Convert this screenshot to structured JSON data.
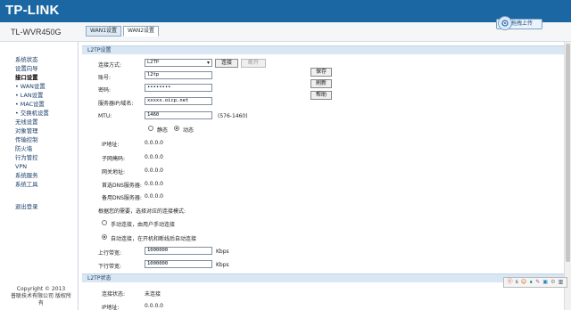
{
  "header": {
    "logo": "TP-LINK",
    "model": "TL-WVR450G"
  },
  "tabs": [
    {
      "label": "WAN1设置",
      "active": false
    },
    {
      "label": "WAN2设置",
      "active": true
    }
  ],
  "drag_button": {
    "label": "拖拽上传"
  },
  "sidebar": {
    "items": [
      {
        "label": "系统状态",
        "active": false
      },
      {
        "label": "设置向导",
        "active": false
      },
      {
        "label": "接口设置",
        "active": true
      },
      {
        "label": "• WAN设置",
        "active": false
      },
      {
        "label": "• LAN设置",
        "active": false
      },
      {
        "label": "• MAC设置",
        "active": false
      },
      {
        "label": "• 交换机设置",
        "active": false
      },
      {
        "label": "无线设置",
        "active": false
      },
      {
        "label": "对象管理",
        "active": false
      },
      {
        "label": "传输控制",
        "active": false
      },
      {
        "label": "防火墙",
        "active": false
      },
      {
        "label": "行为管控",
        "active": false
      },
      {
        "label": "VPN",
        "active": false
      },
      {
        "label": "系统服务",
        "active": false
      },
      {
        "label": "系统工具",
        "active": false
      }
    ],
    "logout": "退出登录",
    "copyright_line1": "Copyright © 2013",
    "copyright_line2": "普联技术有限公司 版权所",
    "copyright_line3": "有"
  },
  "section_l2tp_settings": "L2TP设置",
  "section_l2tp_status": "L2TP状态",
  "form": {
    "conn_type_label": "连接方式:",
    "conn_type_value": "L2TP",
    "connect_button": "连接",
    "disconnect_button": "断开",
    "account_label": "账号:",
    "account_value": "l2tp",
    "password_label": "密码:",
    "password_value": "••••••••",
    "server_label": "服务器IP/域名:",
    "server_value": "xxxxx.oicp.net",
    "mtu_label": "MTU:",
    "mtu_value": "1460",
    "mtu_range": "(576-1460)",
    "static_label": "静态",
    "dynamic_label": "动态",
    "ip_label": "IP地址:",
    "ip_value": "0.0.0.0",
    "mask_label": "子网掩码:",
    "mask_value": "0.0.0.0",
    "gateway_label": "网关地址:",
    "gateway_value": "0.0.0.0",
    "dns1_label": "首选DNS服务器:",
    "dns1_value": "0.0.0.0",
    "dns2_label": "备用DNS服务器:",
    "dns2_value": "0.0.0.0",
    "mode_prompt": "根据您的需要，选择对应的连接模式:",
    "manual_label": "手动连接，由用户手动连接",
    "auto_label": "自动连接，在开机和断线后自动连接",
    "upload_label": "上行带宽:",
    "upload_value": "1000000",
    "download_label": "下行带宽:",
    "download_value": "1000000",
    "kbps": "Kbps"
  },
  "side_buttons": {
    "save": "保存",
    "refresh": "刷新",
    "help": "帮助"
  },
  "status": {
    "conn_state_label": "连接状态:",
    "conn_state_value": "未连接",
    "ip_label": "IP地址:",
    "ip_value": "0.0.0.0"
  },
  "toolbox": {
    "items": [
      "ⓔ",
      "ѕ",
      "☺",
      "∎",
      "✎",
      "▣",
      "⚙",
      "▥"
    ]
  }
}
